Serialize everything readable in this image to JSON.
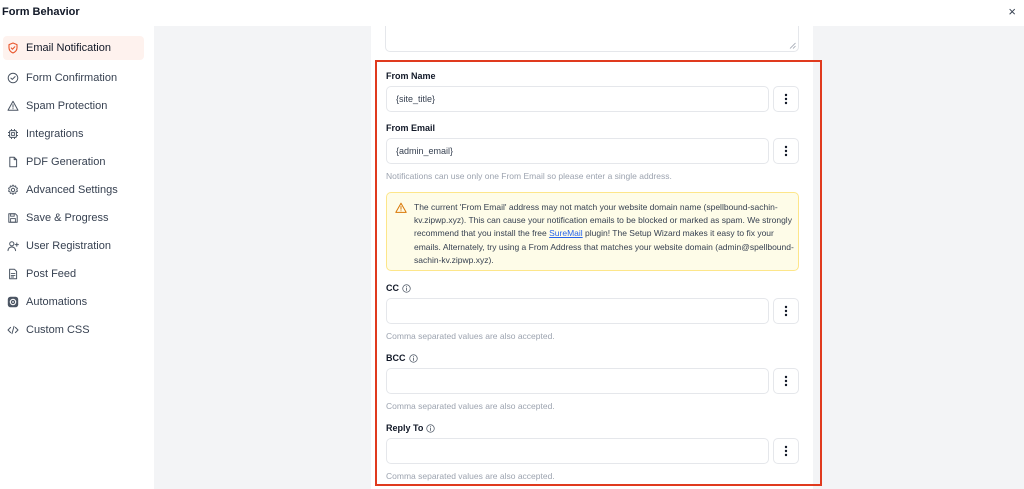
{
  "window": {
    "title": "Form Behavior",
    "close_glyph": "×"
  },
  "sidebar": {
    "items": [
      {
        "label": "Email Notification",
        "icon": "shield-icon",
        "active": true
      },
      {
        "label": "Form Confirmation",
        "icon": "check-circle-icon"
      },
      {
        "label": "Spam Protection",
        "icon": "warning-triangle-icon"
      },
      {
        "label": "Integrations",
        "icon": "chip-icon"
      },
      {
        "label": "PDF Generation",
        "icon": "document-icon"
      },
      {
        "label": "Advanced Settings",
        "icon": "gear-icon"
      },
      {
        "label": "Save & Progress",
        "icon": "save-icon"
      },
      {
        "label": "User Registration",
        "icon": "user-plus-icon"
      },
      {
        "label": "Post Feed",
        "icon": "page-icon"
      },
      {
        "label": "Automations",
        "icon": "automation-icon"
      },
      {
        "label": "Custom CSS",
        "icon": "code-icon"
      }
    ]
  },
  "form": {
    "from_name": {
      "label": "From Name",
      "value": "{site_title}"
    },
    "from_email": {
      "label": "From Email",
      "value": "{admin_email}",
      "help": "Notifications can use only one From Email so please enter a single address."
    },
    "warning": {
      "text_before": "The current 'From Email' address may not match your website domain name (spellbound-sachin-kv.zipwp.xyz). This can cause your notification emails to be blocked or marked as spam. We strongly recommend that you install the free ",
      "link": "SureMail",
      "text_after": " plugin! The Setup Wizard makes it easy to fix your emails. Alternately, try using a From Address that matches your website domain (admin@spellbound-sachin-kv.zipwp.xyz)."
    },
    "cc": {
      "label": "CC",
      "value": "",
      "help": "Comma separated values are also accepted."
    },
    "bcc": {
      "label": "BCC",
      "value": "",
      "help": "Comma separated values are also accepted."
    },
    "reply_to": {
      "label": "Reply To",
      "value": "",
      "help": "Comma separated values are also accepted."
    }
  },
  "colors": {
    "highlight_border": "#e03a1e",
    "active_nav_bg": "#fef2ee",
    "accent_orange": "#e8552b",
    "warning_bg": "#fefce8",
    "warning_border": "#fde68a",
    "link": "#2563eb"
  }
}
